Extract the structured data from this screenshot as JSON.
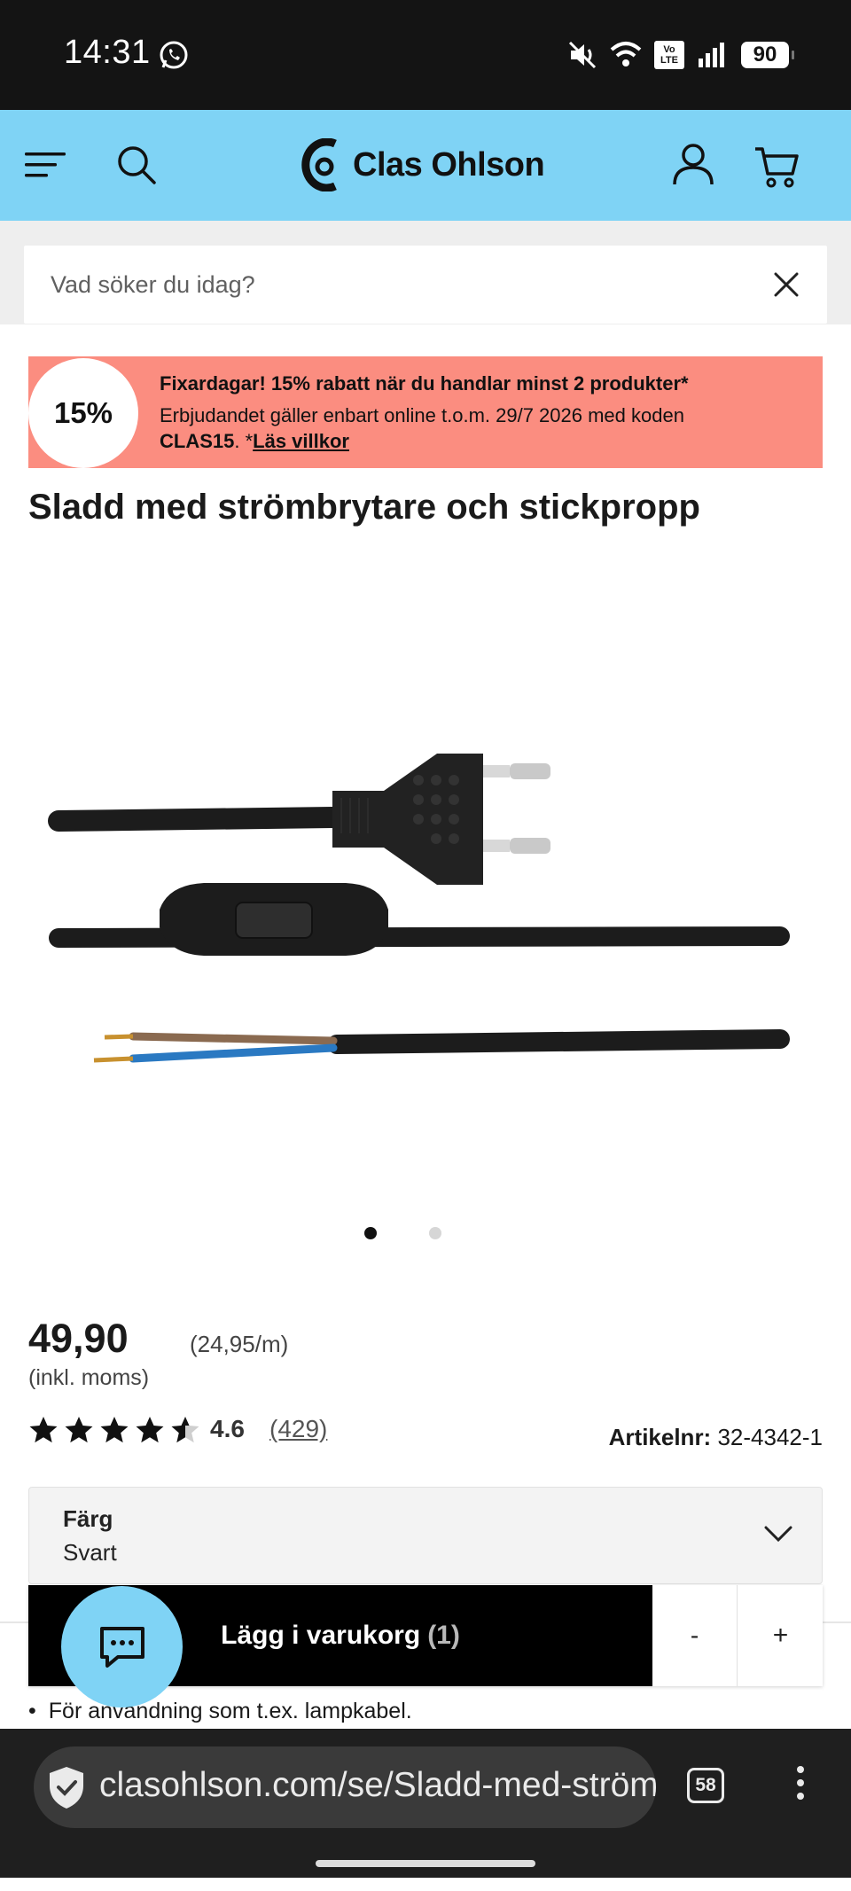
{
  "status_bar": {
    "time": "14:31",
    "battery": "90",
    "volte_top": "Vo",
    "volte_bottom": "LTE",
    "icons": [
      "whatsapp-icon",
      "mute-icon",
      "wifi-icon",
      "volte-icon",
      "signal-icon",
      "battery-icon"
    ]
  },
  "header": {
    "brand": "Clas Ohlson",
    "background": "#7fd3f5",
    "icons": [
      "menu-icon",
      "search-icon",
      "user-icon",
      "cart-icon"
    ]
  },
  "search": {
    "placeholder": "Vad söker du idag?"
  },
  "promo": {
    "badge": "15%",
    "headline": "Fixardagar! 15% rabatt när du handlar minst 2 produkter*",
    "body": "Erbjudandet gäller enbart online t.o.m. 29/7 2026 med koden",
    "code": "CLAS15",
    "suffix": ". *",
    "terms_link": "Läs villkor",
    "background": "#fb8d80"
  },
  "product": {
    "title": "Sladd med strömbrytare och stickpropp",
    "image_count": 2,
    "active_image": 1,
    "price": "49,90",
    "unit_price": "(24,95/m)",
    "vat_note": "(inkl. moms)",
    "rating": "4.6",
    "rating_value": 4.6,
    "reviews": "(429)",
    "article_label": "Artikelnr:",
    "article_number": "32-4342-1",
    "color_label": "Färg",
    "color_value": "Svart",
    "feature_bullet": "För användning som t.ex. lampkabel."
  },
  "cart_bar": {
    "add_label": "Lägg i varukorg",
    "quantity": "(1)",
    "minus": "-",
    "plus": "+"
  },
  "browser": {
    "url": "clasohlson.com/se/Sladd-med-strömbrytare",
    "tab_count": "58"
  }
}
